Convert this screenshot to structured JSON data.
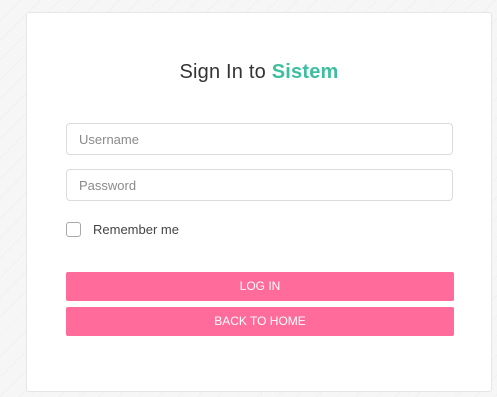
{
  "header": {
    "title_prefix": "Sign In to",
    "title_brand": "Sistem"
  },
  "form": {
    "username": {
      "placeholder": "Username",
      "value": ""
    },
    "password": {
      "placeholder": "Password",
      "value": ""
    },
    "remember": {
      "label": "Remember me",
      "checked": false
    }
  },
  "buttons": {
    "login_label": "LOG IN",
    "home_label": "BACK TO HOME"
  },
  "colors": {
    "brand": "#3dbf9f",
    "button": "#ff6b9a"
  }
}
